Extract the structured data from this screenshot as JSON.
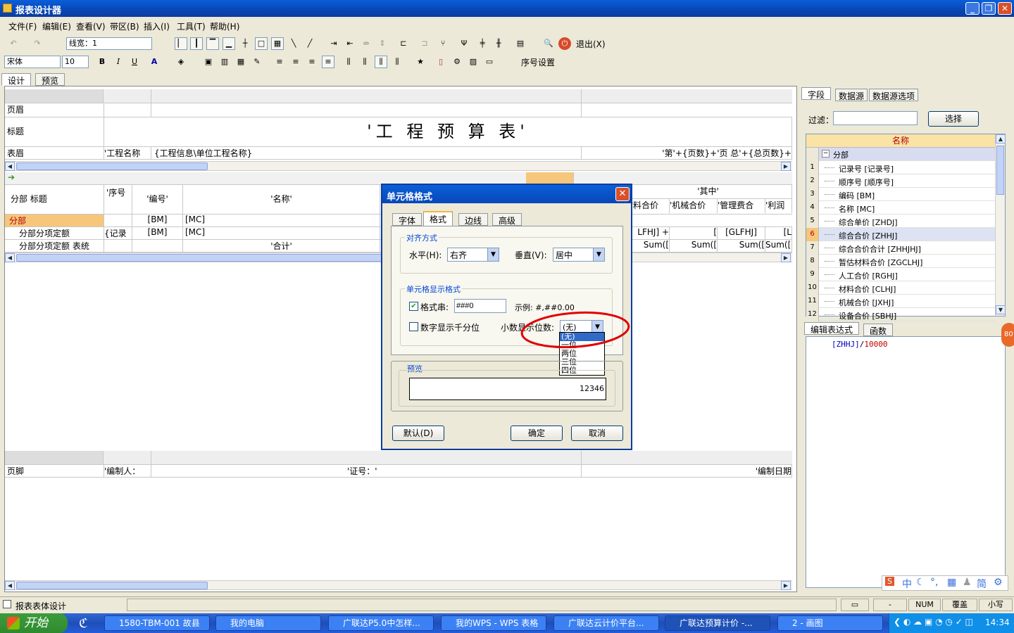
{
  "app": {
    "title": "报表设计器",
    "min": "_",
    "max": "❐",
    "close": "✕"
  },
  "menu": [
    "文件(F)",
    "编辑(E)",
    "查看(V)",
    "带区(B)",
    "插入(I)",
    "工具(T)",
    "帮助(H)"
  ],
  "toolbar1": {
    "line_width_label": "线宽：1",
    "exit_label": "退出(X)"
  },
  "toolbar2": {
    "font": "宋体",
    "size": "10",
    "bold": "B",
    "italic": "I",
    "underline": "U",
    "serial_label": "序号设置"
  },
  "doc_tabs": [
    "设计",
    "预览"
  ],
  "band": {
    "header_label": "页眉",
    "title_label": "标题",
    "title_text": "'工 程 预 算 表'",
    "table_head_label": "表眉",
    "table_head_c1": "'工程名称",
    "table_head_c2": "{工程信息\\单位工程名称}",
    "table_head_c3": "'第'+{页数}+'页 总'+{总页数}+",
    "qizhong": "'其中'",
    "col_header_label": "分部 标题",
    "cols": [
      "'序号",
      "'编号'",
      "'名称'"
    ],
    "right_cols": [
      "材料合价",
      "'机械合价",
      "'管理费合",
      "'利润"
    ],
    "r1_label": "分部",
    "r1_cells": [
      "[BM]",
      "[MC]"
    ],
    "r2_label": "分部分项定额",
    "r2_cells": [
      "{记录",
      "[BM]",
      "[MC]"
    ],
    "r2_right": [
      "LFHJ] +",
      "[",
      "[GLFHJ]",
      "[L"
    ],
    "r3_label": "分部分项定额 表统",
    "r3_mid": "'合计'",
    "r3_right": [
      "Sum([",
      "Sum([",
      "Sum([",
      "Sum(["
    ],
    "footer_label": "页脚",
    "footer_c1": "'编制人：",
    "footer_c2": "'证号：'",
    "footer_c3": "'编制日期"
  },
  "right_panel": {
    "tabs": [
      "字段",
      "数据源",
      "数据源选项"
    ],
    "filter_label": "过滤：",
    "filter_value": "",
    "select_btn": "选择",
    "col_header": "名称",
    "group": "分部",
    "fields": [
      {
        "n": "1",
        "t": "记录号 [记录号]"
      },
      {
        "n": "2",
        "t": "顺序号 [顺序号]"
      },
      {
        "n": "3",
        "t": "编码 [BM]"
      },
      {
        "n": "4",
        "t": "名称 [MC]"
      },
      {
        "n": "5",
        "t": "综合单价 [ZHDJ]"
      },
      {
        "n": "6",
        "t": "综合合价 [ZHHJ]"
      },
      {
        "n": "7",
        "t": "综合合价合计 [ZHHJHJ]"
      },
      {
        "n": "8",
        "t": "暂估材料合价 [ZGCLHJ]"
      },
      {
        "n": "9",
        "t": "人工合价 [RGHJ]"
      },
      {
        "n": "10",
        "t": "材料合价 [CLHJ]"
      },
      {
        "n": "11",
        "t": "机械合价 [JXHJ]"
      },
      {
        "n": "12",
        "t": "设备合价 [SBHJ]"
      }
    ],
    "expr_tabs": [
      "编辑表达式",
      "函数"
    ],
    "expr_field": "[ZHHJ]",
    "expr_op": "/",
    "expr_num": "10000",
    "ime": "中",
    "ime_simp": "简"
  },
  "dialog": {
    "title": "单元格格式",
    "tabs": [
      "字体",
      "格式",
      "边线",
      "高级"
    ],
    "align_group": "对齐方式",
    "h_label": "水平(H):",
    "h_value": "右齐",
    "v_label": "垂直(V):",
    "v_value": "居中",
    "display_group": "单元格显示格式",
    "fmt_label": "格式串:",
    "fmt_value": "###0",
    "example_label": "示例: #,##0.00",
    "thousand_label": "数字显示千分位",
    "decimal_label": "小数显示位数:",
    "decimal_value": "(无)",
    "decimal_options": [
      "(无)",
      "一位",
      "两位",
      "三位",
      "四位"
    ],
    "preview_group": "预览",
    "preview_value": "12346",
    "default_btn": "默认(D)",
    "ok_btn": "确定",
    "cancel_btn": "取消"
  },
  "statusbar": {
    "text": "报表表体设计",
    "num": "NUM",
    "overwrite": "覆盖",
    "lower": "小写",
    "dash": "-"
  },
  "taskbar": {
    "start": "开始",
    "tasks": [
      "1580-TBM-001 故县",
      "我的电脑",
      "广联达P5.0中怎样...",
      "我的WPS - WPS 表格",
      "广联达云计价平台...",
      "广联达预算计价 -...",
      "2 - 画图"
    ],
    "clock": "14:34"
  },
  "badge": "80"
}
